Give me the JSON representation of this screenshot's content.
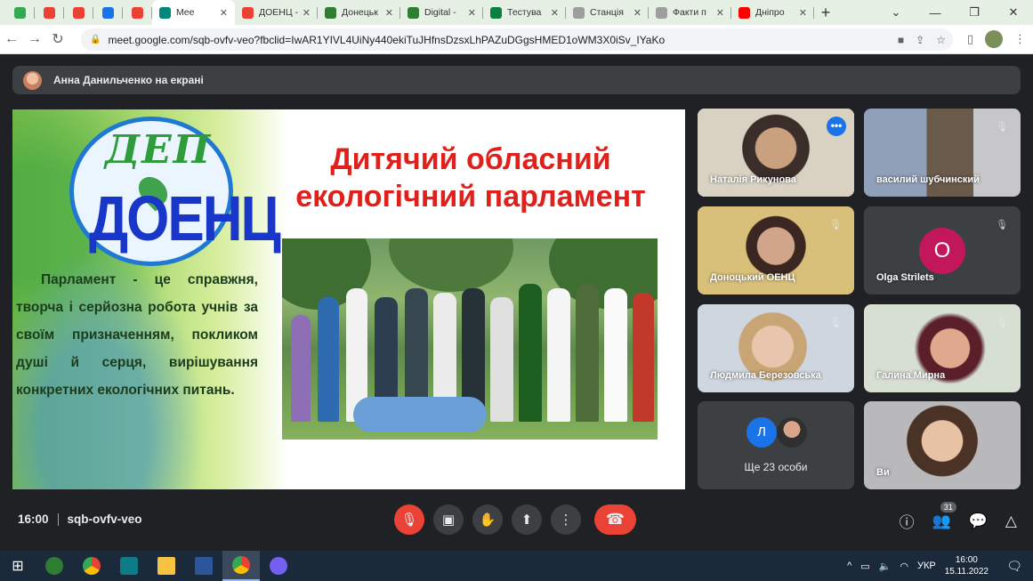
{
  "browser": {
    "tabs": [
      {
        "title": "",
        "icon": "classroom-icon",
        "color": "#34a853"
      },
      {
        "title": "",
        "icon": "gmail-icon",
        "color": "#ea4335"
      },
      {
        "title": "",
        "icon": "gmail-icon",
        "color": "#ea4335"
      },
      {
        "title": "",
        "icon": "chrome-icon",
        "color": "#1a73e8"
      },
      {
        "title": "",
        "icon": "gmail-icon",
        "color": "#ea4335"
      },
      {
        "title": "Mee",
        "icon": "meet-icon",
        "color": "#00897b",
        "active": true
      },
      {
        "title": "ДОЕНЦ -",
        "icon": "maps-icon",
        "color": "#ea4335"
      },
      {
        "title": "Донецьк",
        "icon": "site-icon",
        "color": "#2e7d32"
      },
      {
        "title": "Digital -",
        "icon": "site-icon",
        "color": "#2e7d32"
      },
      {
        "title": "Тестува",
        "icon": "puzzle-icon",
        "color": "#0b8043"
      },
      {
        "title": "Станція",
        "icon": "page-icon",
        "color": "#9e9e9e"
      },
      {
        "title": "Факти п",
        "icon": "page-icon",
        "color": "#9e9e9e"
      },
      {
        "title": "Дніпро",
        "icon": "youtube-icon",
        "color": "#ff0000"
      }
    ],
    "url": "meet.google.com/sqb-ovfv-veo?fbclid=IwAR1YIVL4UiNy440ekiTuJHfnsDzsxLhPAZuDGgsHMED1oWM3X0iSv_IYaKo"
  },
  "meet": {
    "presenter_banner": "Анна Данильченко на екрані",
    "slide": {
      "logo_top": "ДЕП",
      "logo_bottom": "ДОЕНЦ",
      "title_line1": "Дитячий обласний",
      "title_line2": "екологічний парламент",
      "body": "Парламент - це справжня, творча і серйозна робота учнів за своїм призначенням, покликом душі й серця, вирішування конкретних екологічних питань."
    },
    "participants": [
      {
        "name": "Наталія Рикунова",
        "active": true,
        "muted": false
      },
      {
        "name": "василий шубчинский",
        "muted": true
      },
      {
        "name": "Доноцький ОЕНЦ",
        "muted": true
      },
      {
        "name": "Olga Strilets",
        "muted": true,
        "avatar_letter": "O",
        "avatar_color": "#c2185b"
      },
      {
        "name": "Людмила Березовська",
        "muted": true
      },
      {
        "name": "Галина Мирна",
        "muted": true
      },
      {
        "name": "Ви",
        "muted": false
      }
    ],
    "more": {
      "label": "Ще 23 особи",
      "avatar_letter": "Л"
    },
    "time": "16:00",
    "meeting_code": "sqb-ovfv-veo",
    "people_count": "31"
  },
  "taskbar": {
    "language": "УКР",
    "time": "16:00",
    "date": "15.11.2022"
  }
}
